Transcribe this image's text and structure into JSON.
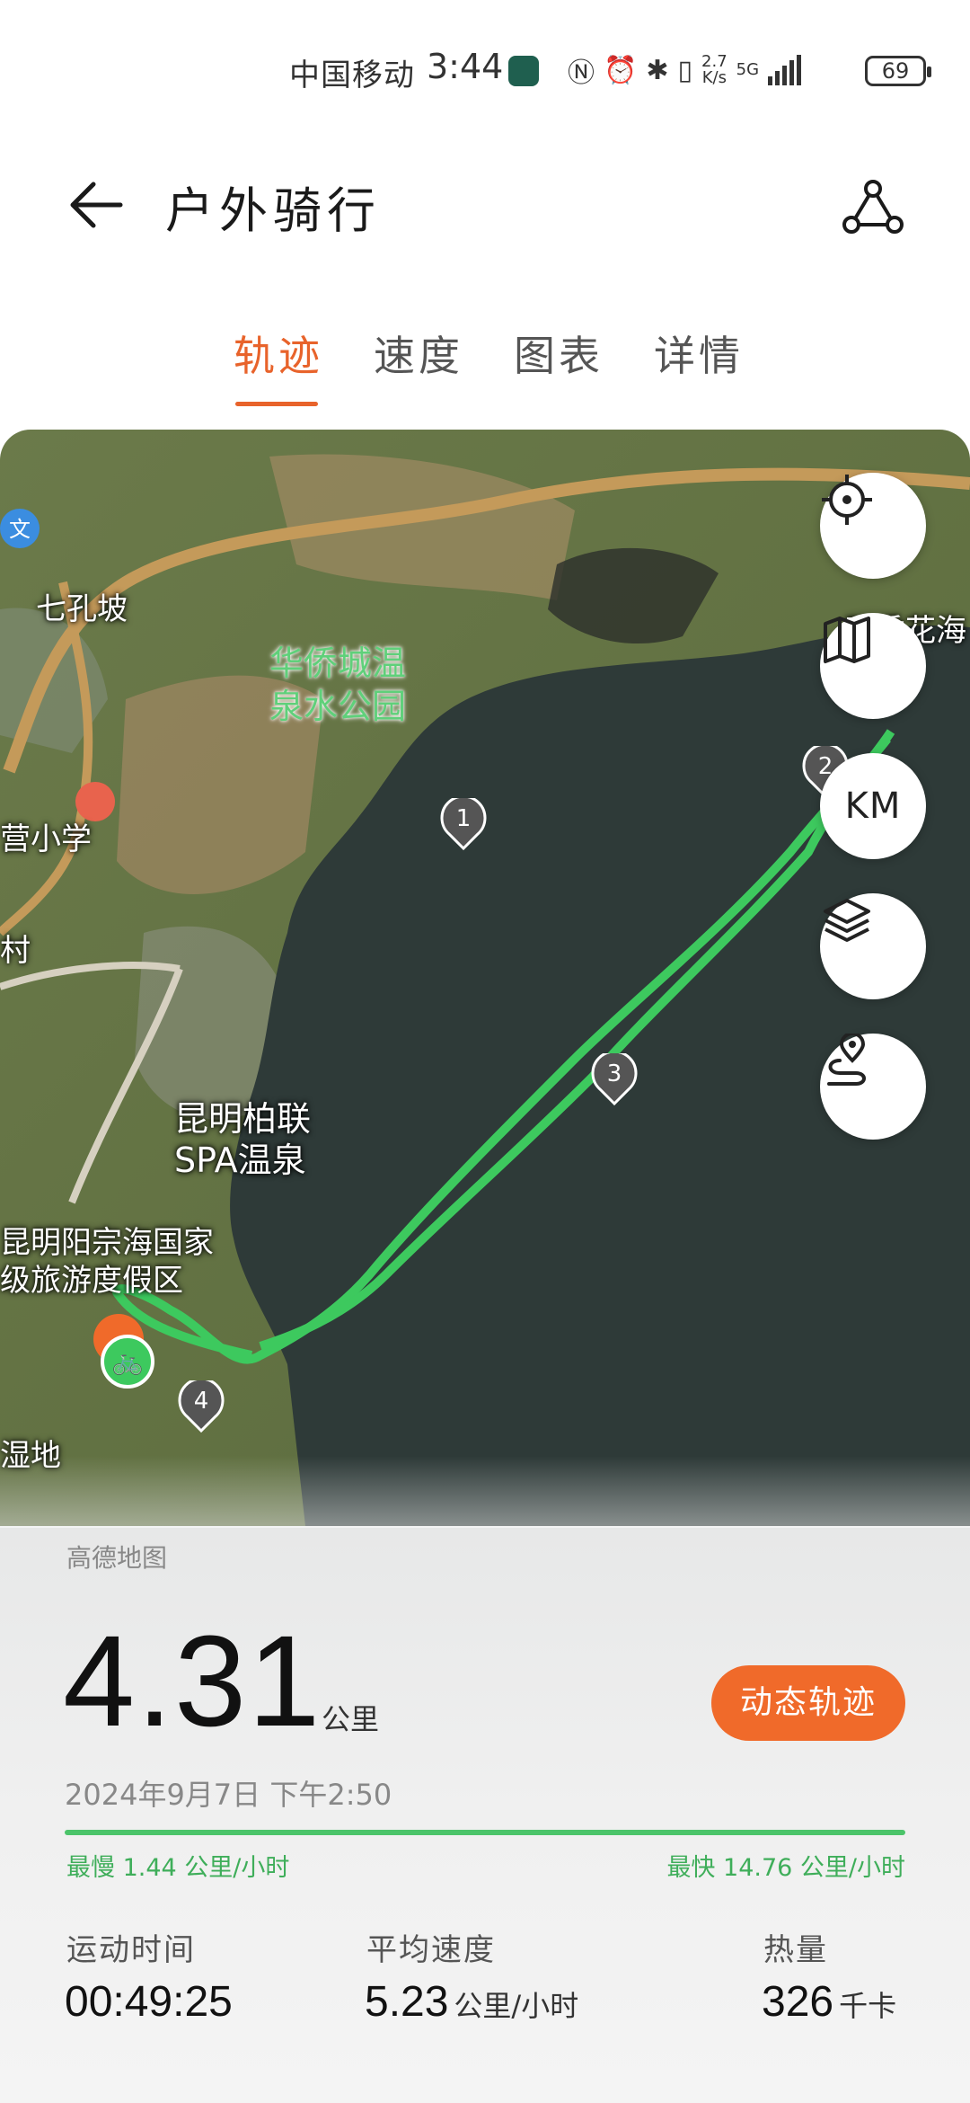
{
  "status_bar": {
    "carrier": "中国移动",
    "time": "3:44",
    "net_speed_value": "2.7",
    "net_speed_unit": "K/s",
    "network_type": "5G",
    "battery": "69"
  },
  "header": {
    "title": "户外骑行"
  },
  "tabs": [
    {
      "label": "轨迹",
      "active": true
    },
    {
      "label": "速度",
      "active": false
    },
    {
      "label": "图表",
      "active": false
    },
    {
      "label": "详情",
      "active": false
    }
  ],
  "map": {
    "labels": {
      "qikongpo": "七孔坡",
      "park": "华侨城温泉水公园",
      "park_line1": "华侨城温",
      "park_line2": "泉水公园",
      "school": "营小学",
      "spa_line1": "昆明柏联",
      "spa_line2": "SPA温泉",
      "resort_line1": "昆明阳宗海国家",
      "resort_line2": "级旅游度假区",
      "flower_sea": "四季花海",
      "wetland": "湿地",
      "edge_char": "村"
    },
    "markers": [
      "1",
      "2",
      "3",
      "4"
    ],
    "controls": {
      "km_label": "KM"
    },
    "accent_track_color": "#3dc95e"
  },
  "summary": {
    "map_provider": "高德地图",
    "distance": "4.31",
    "distance_unit": "公里",
    "dynamic_track_button": "动态轨迹",
    "datetime": "2024年9月7日 下午2:50",
    "slowest": "最慢 1.44 公里/小时",
    "fastest": "最快 14.76 公里/小时"
  },
  "stats": {
    "duration": {
      "label": "运动时间",
      "value": "00:49:25"
    },
    "avg_speed": {
      "label": "平均速度",
      "value": "5.23",
      "unit": "公里/小时"
    },
    "calories": {
      "label": "热量",
      "value": "326",
      "unit": "千卡"
    }
  },
  "colors": {
    "accent": "#e8632b",
    "button": "#f06a2a",
    "track": "#3dc95e"
  }
}
